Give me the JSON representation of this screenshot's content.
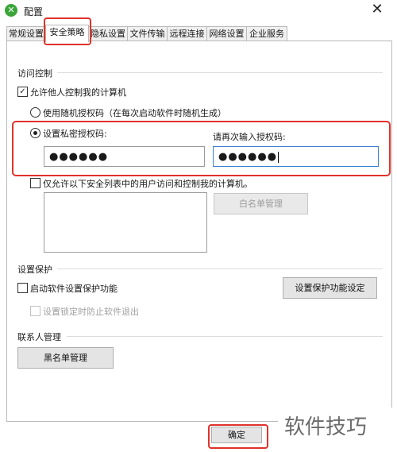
{
  "window": {
    "title": "配置",
    "app_icon": "wechat-like-icon",
    "close_glyph": "✕"
  },
  "tabs": [
    {
      "label": "常规设置",
      "active": false
    },
    {
      "label": "安全策略",
      "active": true
    },
    {
      "label": "隐私设置",
      "active": false
    },
    {
      "label": "文件传输",
      "active": false
    },
    {
      "label": "远程连接",
      "active": false
    },
    {
      "label": "网络设置",
      "active": false
    },
    {
      "label": "企业服务",
      "active": false
    }
  ],
  "access_control": {
    "group_title": "访问控制",
    "allow_control": {
      "label": "允许他人控制我的计算机",
      "checked": true,
      "check_glyph": "✓"
    },
    "random_code": {
      "label": "使用随机授权码（在每次启动软件时随机生成）",
      "selected": false
    },
    "private_code": {
      "label": "设置私密授权码:",
      "selected": true,
      "value": "●●●●●●"
    },
    "confirm_code": {
      "label": "请再次输入授权码:",
      "value": "●●●●●●"
    },
    "whitelist_only": {
      "label": "仅允许以下安全列表中的用户访问和控制我的计算机。",
      "checked": false
    },
    "whitelist_button": "白名单管理"
  },
  "protection": {
    "group_title": "设置保护",
    "enable": {
      "label": "启动软件设置保护功能",
      "checked": false
    },
    "lock_exit": {
      "label": "设置锁定时防止软件退出",
      "checked": false
    },
    "settings_button": "设置保护功能设定"
  },
  "contacts": {
    "group_title": "联系人管理",
    "blacklist_button": "黑名单管理"
  },
  "footer": {
    "ok_button": "确定"
  },
  "watermark": "软件技巧",
  "colors": {
    "highlight": "#e0322b",
    "focus": "#3c7fd1"
  }
}
